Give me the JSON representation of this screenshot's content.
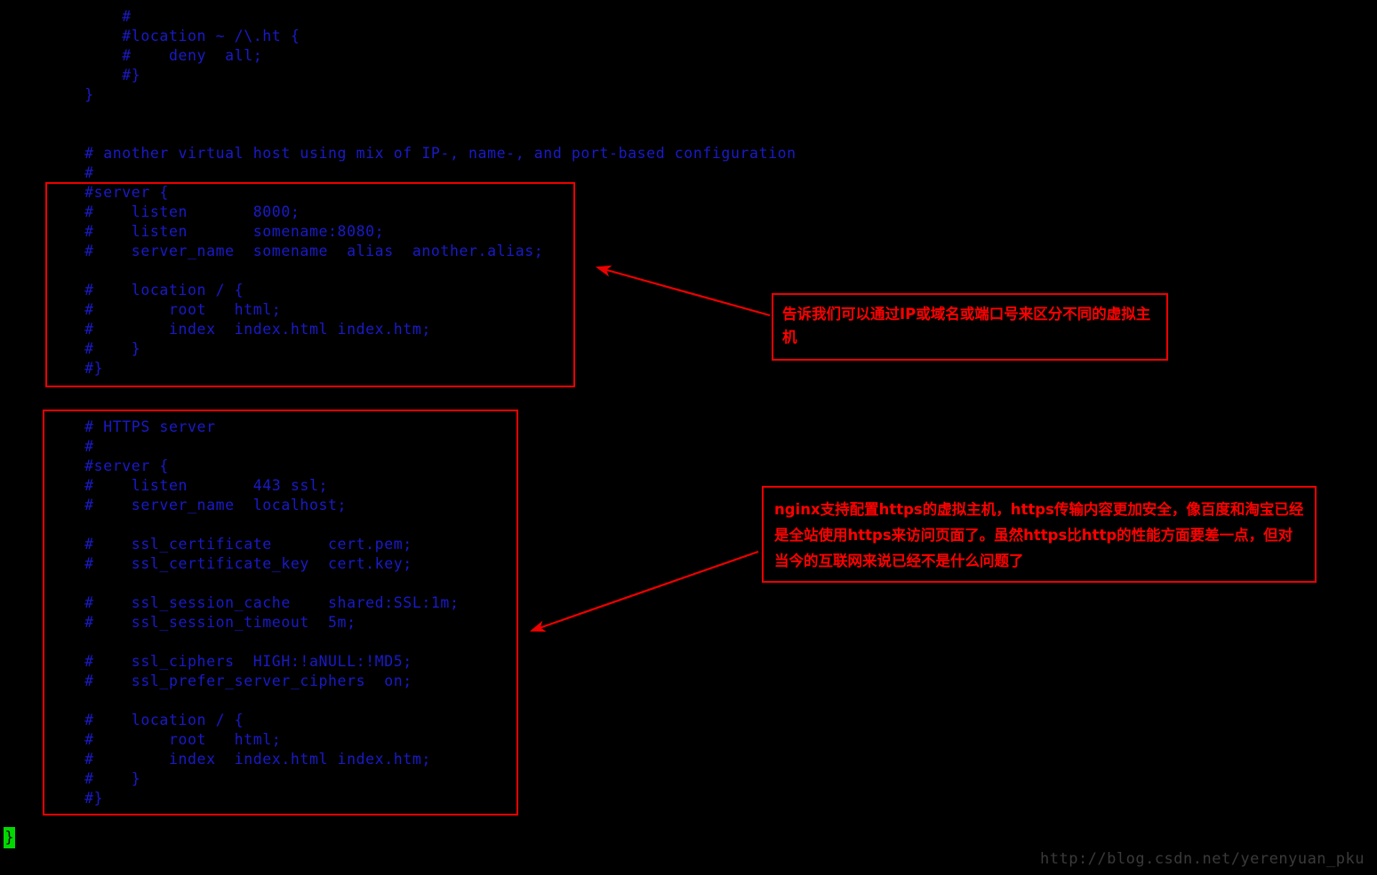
{
  "window": {
    "background_color": "#000000",
    "code_color": "#1a1ac8",
    "annotation_color": "#ff0000",
    "border_color": "#ee0000",
    "highlight_color": "#00d900"
  },
  "code": {
    "language": "nginx-conf",
    "text": "        #\n        #location ~ /\\.ht {\n        #    deny  all;\n        #}\n    }\n\n\n    # another virtual host using mix of IP-, name-, and port-based configuration\n    #\n    #server {\n    #    listen       8000;\n    #    listen       somename:8080;\n    #    server_name  somename  alias  another.alias;\n\n    #    location / {\n    #        root   html;\n    #        index  index.html index.htm;\n    #    }\n    #}\n\n\n    # HTTPS server\n    #\n    #server {\n    #    listen       443 ssl;\n    #    server_name  localhost;\n\n    #    ssl_certificate      cert.pem;\n    #    ssl_certificate_key  cert.key;\n\n    #    ssl_session_cache    shared:SSL:1m;\n    #    ssl_session_timeout  5m;\n\n    #    ssl_ciphers  HIGH:!aNULL:!MD5;\n    #    ssl_prefer_server_ciphers  on;\n\n    #    location / {\n    #        root   html;\n    #        index  index.html index.htm;\n    #    }\n    #}",
    "closing_brace_line": "}"
  },
  "cursor": {
    "character": "}"
  },
  "annotations": {
    "virtual_host_note": "告诉我们可以通过IP或域名或端口号来区分不同的虚拟主机",
    "https_note": "nginx支持配置https的虚拟主机，https传输内容更加安全，像百度和淘宝已经是全站使用https来访问页面了。虽然https比http的性能方面要差一点，但对当今的互联网来说已经不是什么问题了"
  },
  "watermark": {
    "url": "http://blog.csdn.net/yerenyuan_pku"
  }
}
